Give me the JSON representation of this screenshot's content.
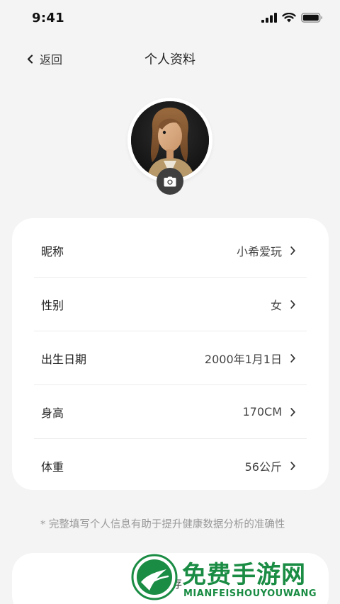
{
  "status_bar": {
    "time": "9:41"
  },
  "nav": {
    "back_label": "返回",
    "title": "个人资料"
  },
  "profile_rows": [
    {
      "label": "昵称",
      "value": "小希爱玩"
    },
    {
      "label": "性别",
      "value": "女"
    },
    {
      "label": "出生日期",
      "value": "2000年1月1日"
    },
    {
      "label": "身高",
      "value": "170CM"
    },
    {
      "label": "体重",
      "value": "56公斤"
    }
  ],
  "hint": "* 完整填写个人信息有助于提升健康数据分析的准确性",
  "save_label": "保存",
  "watermark": {
    "title": "免费手游网",
    "subtitle": "MIANFEISHOUYOUWANG"
  },
  "colors": {
    "background": "#f4f4f4",
    "card": "#ffffff",
    "watermark": "#1a8c43"
  }
}
